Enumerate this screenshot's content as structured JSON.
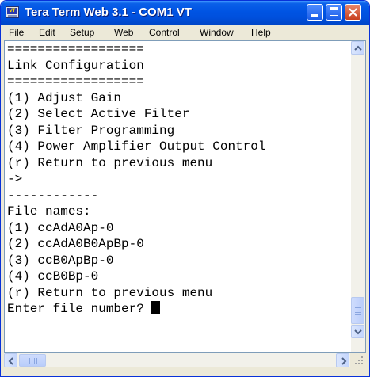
{
  "window": {
    "title": "Tera Term Web 3.1 - COM1 VT",
    "app_icon": "teraterm-icon",
    "controls": [
      "minimize-icon",
      "maximize-icon",
      "close-icon"
    ]
  },
  "menu": [
    "File",
    "Edit",
    "Setup",
    "Web",
    "Control",
    "Window",
    "Help"
  ],
  "terminal": {
    "lines": [
      "==================",
      "Link Configuration",
      "==================",
      "(1) Adjust Gain",
      "(2) Select Active Filter",
      "(3) Filter Programming",
      "(4) Power Amplifier Output Control",
      "(r) Return to previous menu",
      "->",
      "------------",
      "File names:",
      "(1) ccAdA0Ap-0",
      "(2) ccAdA0B0ApBp-0",
      "(3) ccB0ApBp-0",
      "(4) ccB0Bp-0",
      "(r) Return to previous menu",
      "Enter file number? "
    ]
  },
  "scrollbars": {
    "vertical": [
      "scroll-up-arrow-icon",
      "scroll-down-arrow-icon"
    ],
    "horizontal": [
      "scroll-left-arrow-icon",
      "scroll-right-arrow-icon"
    ]
  },
  "colors": {
    "titlebar": "#0054e3",
    "terminal_bg": "#ffffff",
    "terminal_fg": "#000000",
    "close_button": "#c8401f"
  }
}
